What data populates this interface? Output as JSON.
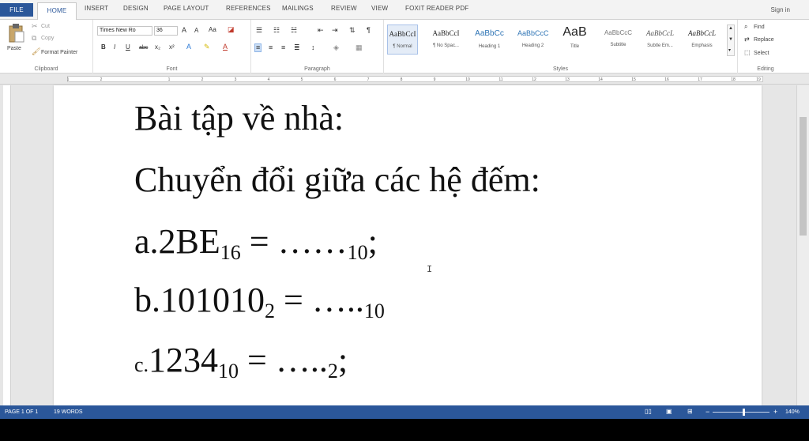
{
  "tabs": {
    "file": "FILE",
    "home": "HOME",
    "insert": "INSERT",
    "design": "DESIGN",
    "page_layout": "PAGE LAYOUT",
    "references": "REFERENCES",
    "mailings": "MAILINGS",
    "review": "REVIEW",
    "view": "VIEW",
    "foxit": "FOXIT READER PDF"
  },
  "signin": "Sign in",
  "clipboard": {
    "paste": "Paste",
    "cut": "Cut",
    "copy": "Copy",
    "format_painter": "Format Painter",
    "label": "Clipboard"
  },
  "font": {
    "name": "Times New Ro",
    "size": "36",
    "grow": "A",
    "shrink": "A",
    "case": "Aa",
    "bold": "B",
    "italic": "I",
    "underline": "U",
    "strike": "abc",
    "subscript": "x₂",
    "superscript": "x²",
    "label": "Font"
  },
  "paragraph": {
    "label": "Paragraph"
  },
  "styles": {
    "label": "Styles",
    "items": [
      {
        "preview": "AaBbCcI",
        "name": "¶ Normal"
      },
      {
        "preview": "AaBbCcI",
        "name": "¶ No Spac..."
      },
      {
        "preview": "AaBbCc",
        "name": "Heading 1"
      },
      {
        "preview": "AaBbCcC",
        "name": "Heading 2"
      },
      {
        "preview": "AaB",
        "name": "Title"
      },
      {
        "preview": "AaBbCcC",
        "name": "Subtitle"
      },
      {
        "preview": "AaBbCcL",
        "name": "Subtle Em..."
      },
      {
        "preview": "AaBbCcL",
        "name": "Emphasis"
      }
    ]
  },
  "editing": {
    "find": "Find",
    "replace": "Replace",
    "select": "Select",
    "label": "Editing"
  },
  "ruler": {
    "ticks": [
      "1",
      "2",
      "1",
      "2",
      "3",
      "4",
      "5",
      "6",
      "7",
      "8",
      "9",
      "10",
      "11",
      "12",
      "13",
      "14",
      "15",
      "16",
      "17",
      "18",
      "19"
    ]
  },
  "document": {
    "line1": "Bài tập về nhà:",
    "line2": "Chuyển đổi giữa các hệ đếm:",
    "line3": {
      "pre": "a.2BE",
      "sub1": "16",
      "mid": " = ……",
      "sub2": "10",
      "post": ";"
    },
    "line4": {
      "pre": "b.101010",
      "sub1": "2",
      "mid": " = …..",
      "sub2": "10"
    },
    "line5": {
      "lead": "c.",
      "pre": "1234",
      "sub1": "10",
      "mid": " = …..",
      "sub2": "2",
      "post": ";"
    }
  },
  "status": {
    "page": "PAGE 1 OF 1",
    "words": "19 WORDS",
    "zoom": "140%"
  },
  "colors": {
    "accent": "#2b579a",
    "ribbon_bg": "#ffffff",
    "page_bg": "#ffffff"
  }
}
